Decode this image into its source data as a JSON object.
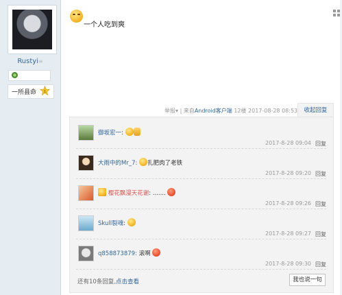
{
  "author": {
    "username": "Rustyi",
    "medal_label": "一所县命"
  },
  "post": {
    "text": "一个人吃到爽",
    "report_label": "举报",
    "source_prefix": "来自",
    "source_link": "Android客户端",
    "floor": "12楼",
    "timestamp": "2017-08-28 08:53",
    "collapse_label": "收起回复"
  },
  "replies": [
    {
      "name": "御坂宏一",
      "content": ":",
      "time": "2017-8-28 09:04",
      "reply_label": "回复"
    },
    {
      "name": "大雨中的Mr_7",
      "content": "扎肥肉了老铁",
      "time": "2017-8-28 09:20",
      "reply_label": "回复"
    },
    {
      "name": "樱花飘漫天花谢",
      "content": ": .......",
      "time": "2017-8-28 09:26",
      "reply_label": "回复"
    },
    {
      "name": "Skull裂魂",
      "content": ":",
      "time": "2017-8-28 09:27",
      "reply_label": "回复"
    },
    {
      "name": "q858873879",
      "content": "滚啊",
      "time": "2017-8-28 09:30",
      "reply_label": "回复"
    }
  ],
  "footer": {
    "count_text": "还有10条回复,",
    "view_link": "点击查看",
    "say_button": "我也说一句"
  },
  "colors": {
    "link": "#336699",
    "sidebar": "#e5edf2",
    "reply_bg": "#f3f3f3"
  }
}
